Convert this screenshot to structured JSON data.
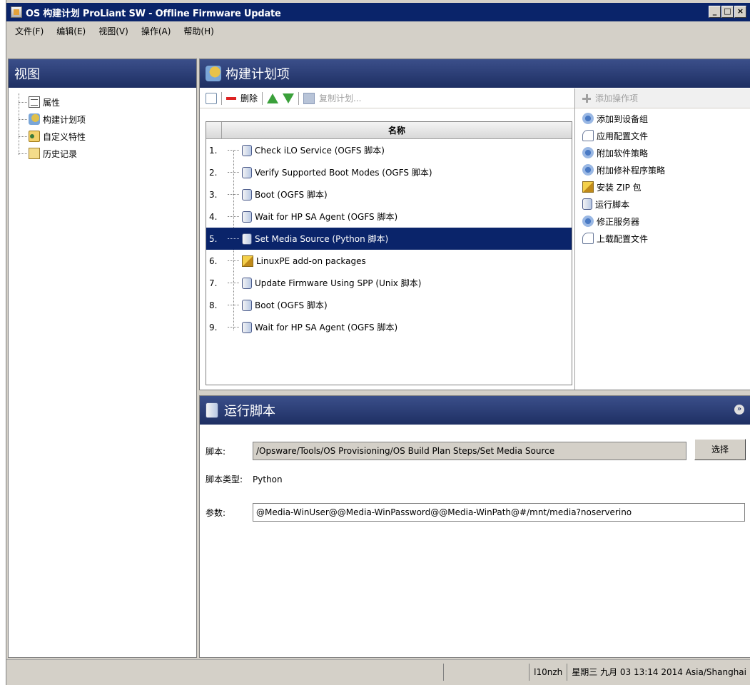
{
  "window": {
    "title": "OS 构建计划 ProLiant SW - Offline Firmware Update",
    "min": "_",
    "max": "□",
    "close": "×"
  },
  "menu": [
    "文件(F)",
    "编辑(E)",
    "视图(V)",
    "操作(A)",
    "帮助(H)"
  ],
  "left": {
    "header": "视图",
    "items": [
      {
        "label": "属性",
        "icon": "document-icon"
      },
      {
        "label": "构建计划项",
        "icon": "build-plan-icon"
      },
      {
        "label": "自定义特性",
        "icon": "custom-attributes-icon"
      },
      {
        "label": "历史记录",
        "icon": "history-icon"
      }
    ]
  },
  "main": {
    "header": "构建计划项",
    "toolbar": {
      "delete_label": "删除",
      "copy_label": "复制计划..."
    },
    "column_name": "名称",
    "steps": [
      {
        "num": "1.",
        "label": "Check iLO Service (OGFS 脚本)",
        "icon": "script-icon"
      },
      {
        "num": "2.",
        "label": "Verify Supported Boot Modes (OGFS 脚本)",
        "icon": "script-icon"
      },
      {
        "num": "3.",
        "label": "Boot (OGFS 脚本)",
        "icon": "script-icon"
      },
      {
        "num": "4.",
        "label": "Wait for HP SA Agent (OGFS 脚本)",
        "icon": "script-icon"
      },
      {
        "num": "5.",
        "label": "Set Media Source (Python 脚本)",
        "icon": "script-icon"
      },
      {
        "num": "6.",
        "label": "LinuxPE add-on packages",
        "icon": "package-icon"
      },
      {
        "num": "7.",
        "label": "Update Firmware Using SPP (Unix 脚本)",
        "icon": "script-icon"
      },
      {
        "num": "8.",
        "label": "Boot (OGFS 脚本)",
        "icon": "script-icon"
      },
      {
        "num": "9.",
        "label": "Wait for HP SA Agent (OGFS 脚本)",
        "icon": "script-icon"
      }
    ],
    "selected_step": 5
  },
  "actions": {
    "header": "添加操作项",
    "items": [
      {
        "label": "添加到设备组",
        "icon": "device-group-icon"
      },
      {
        "label": "应用配置文件",
        "icon": "config-file-icon"
      },
      {
        "label": "附加软件策略",
        "icon": "software-policy-icon"
      },
      {
        "label": "附加修补程序策略",
        "icon": "patch-policy-icon"
      },
      {
        "label": "安装 ZIP 包",
        "icon": "zip-package-icon"
      },
      {
        "label": "运行脚本",
        "icon": "run-script-icon"
      },
      {
        "label": "修正服务器",
        "icon": "remediate-server-icon"
      },
      {
        "label": "上载配置文件",
        "icon": "upload-config-icon"
      }
    ]
  },
  "detail": {
    "header": "运行脚本",
    "script_label": "脚本:",
    "script_value": "/Opsware/Tools/OS Provisioning/OS Build Plan Steps/Set Media Source",
    "select_button": "选择",
    "type_label": "脚本类型:",
    "type_value": "Python",
    "params_label": "参数:",
    "params_value": "@Media-WinUser@@Media-WinPassword@@Media-WinPath@#/mnt/media?noserverino"
  },
  "status": {
    "user": "l10nzh",
    "datetime": "星期三 九月 03 13:14 2014 Asia/Shanghai"
  },
  "colors": {
    "titlebar": "#0a246a",
    "panel_header": "#1e2f63",
    "selection": "#0a246a",
    "chrome": "#d4d0c8"
  }
}
